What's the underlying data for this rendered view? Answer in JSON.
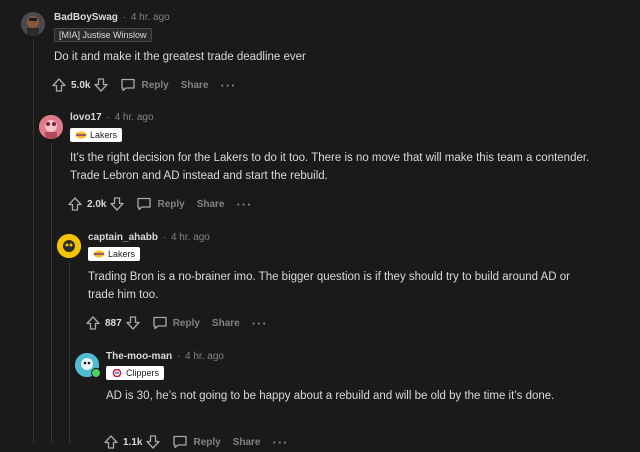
{
  "comments": [
    {
      "username": "BadBoySwag",
      "time": "4 hr. ago",
      "flair": "[MIA] Justise Winslow",
      "text": "Do it and make it the greatest trade deadline ever",
      "votes": "5.0k",
      "reply": "Reply",
      "share": "Share"
    },
    {
      "username": "lovo17",
      "time": "4 hr. ago",
      "flair": "Lakers",
      "text": "It’s the right decision for the Lakers to do it too. There is no move that will make this team a contender. Trade Lebron and AD instead and start the rebuild.",
      "votes": "2.0k",
      "reply": "Reply",
      "share": "Share"
    },
    {
      "username": "captain_ahabb",
      "time": "4 hr. ago",
      "flair": "Lakers",
      "text": "Trading Bron is a no-brainer imo. The bigger question is if they should try to build around AD or trade him too.",
      "votes": "887",
      "reply": "Reply",
      "share": "Share"
    },
    {
      "username": "The-moo-man",
      "time": "4 hr. ago",
      "flair": "Clippers",
      "text": "AD is 30, he’s not going to be happy about a rebuild and will be old by the time it’s done.",
      "votes": "1.1k",
      "reply": "Reply",
      "share": "Share"
    }
  ],
  "separator": "·"
}
